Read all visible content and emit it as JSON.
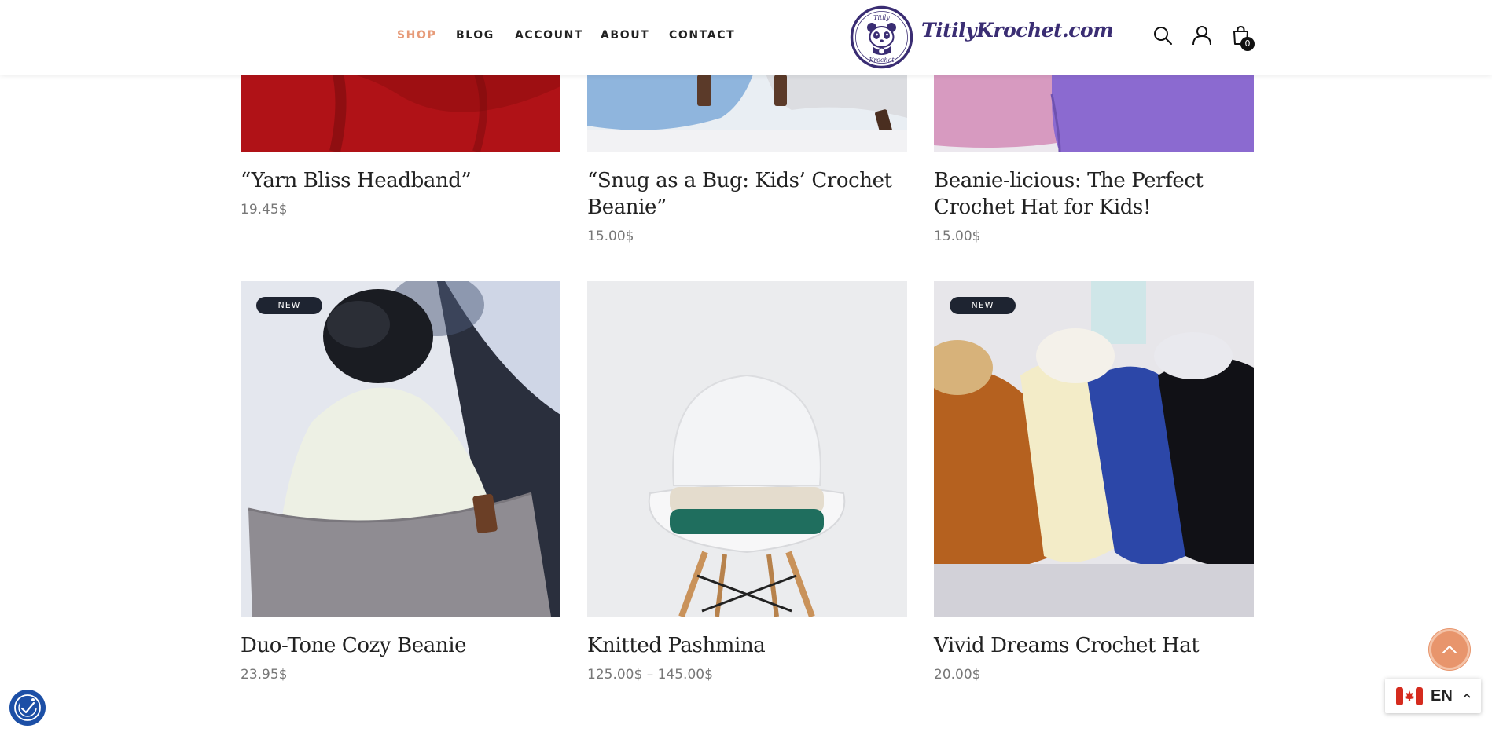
{
  "nav": {
    "items": [
      {
        "label": "SHOP",
        "active": true
      },
      {
        "label": "BLOG",
        "active": false
      },
      {
        "label": "ACCOUNT",
        "active": false
      },
      {
        "label": "ABOUT",
        "active": false
      },
      {
        "label": "CONTACT",
        "active": false
      }
    ]
  },
  "brand": {
    "badge_top": "Titily",
    "badge_bottom": "Krochet",
    "name": "TitilyKrochet.com"
  },
  "header_icons": {
    "search": "search-icon",
    "account": "user-icon",
    "cart": "shopping-bag-icon",
    "cart_count": "0"
  },
  "products": [
    {
      "title": "“Yarn Bliss Headband”",
      "price": "19.45$",
      "badge": ""
    },
    {
      "title": "“Snug as a Bug: Kids’ Crochet Beanie”",
      "price": "15.00$",
      "badge": ""
    },
    {
      "title": "Beanie-licious: The Perfect Crochet Hat for Kids!",
      "price": "15.00$",
      "badge": ""
    },
    {
      "title": "Duo-Tone Cozy Beanie",
      "price": "23.95$",
      "badge": "NEW"
    },
    {
      "title": "Knitted Pashmina",
      "price": "125.00$ – 145.00$",
      "badge": ""
    },
    {
      "title": "Vivid Dreams Crochet Hat",
      "price": "20.00$",
      "badge": "NEW"
    }
  ],
  "language": {
    "code": "EN",
    "flag": "canada-flag-icon"
  },
  "widgets": {
    "scroll_top": "chevron-up-icon",
    "accessibility": "accessibility-icon"
  },
  "colors": {
    "accent": "#e79b79",
    "badge_bg": "#1e2431",
    "brand": "#3a2d73"
  }
}
